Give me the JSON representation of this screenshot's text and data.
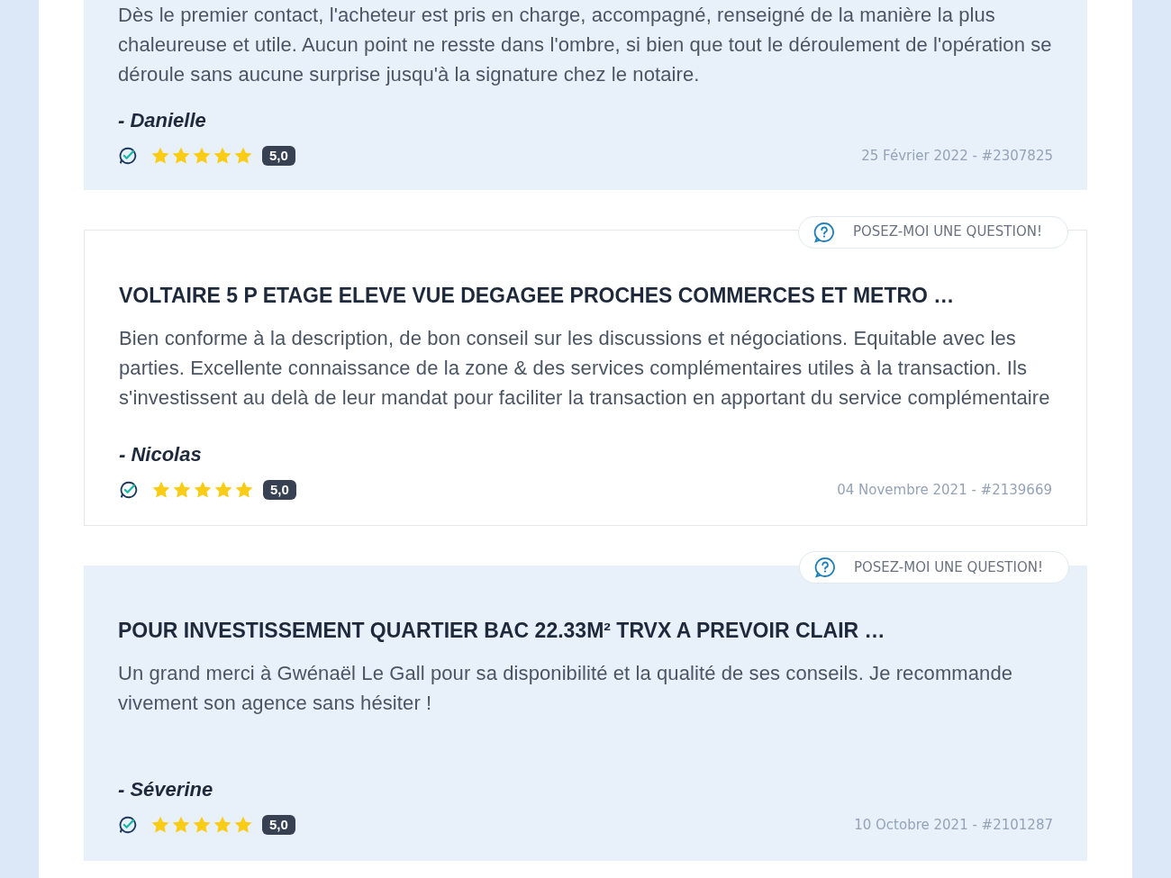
{
  "reviews": [
    {
      "kind": "tinted",
      "body": "Dès le premier contact, l'acheteur est pris en charge, accompagné, renseigné de la manière la plus chaleureuse et utile. Aucun point ne resste dans l'ombre, si bien que tout le déroulement de l'opération se déroule sans aucune surprise jusqu'à la signature chez le notaire.",
      "author": "- Danielle",
      "verified": true,
      "stars": 5,
      "rating": "5,0",
      "date": "25 Février 2022 - #2307825"
    },
    {
      "kind": "plain",
      "title": "VOLTAIRE 5 P ETAGE ELEVE VUE DEGAGEE PROCHES COMMERCES ET METRO …",
      "ask_button": "POSEZ-MOI UNE QUESTION!",
      "body": "Bien conforme à la description, de bon conseil sur les discussions et négociations. Equitable avec les parties. Excellente connaissance de la zone & des services complémentaires utiles à la transaction. Ils s'investissent au delà de leur mandat pour faciliter la transaction en apportant du service complémentaire",
      "author": "- Nicolas",
      "verified": true,
      "stars": 5,
      "rating": "5,0",
      "date": "04 Novembre 2021 - #2139669"
    },
    {
      "kind": "tinted",
      "title": "POUR INVESTISSEMENT QUARTIER BAC 22.33M² TRVX A PREVOIR CLAIR …",
      "ask_button": "POSEZ-MOI UNE QUESTION!",
      "body": "Un grand merci à Gwénaël Le Gall pour sa disponibilité et la qualité de ses conseils. Je recommande vivement son agence sans hésiter !",
      "author": "- Séverine",
      "verified": true,
      "stars": 5,
      "rating": "5,0",
      "date": "10 Octobre 2021 - #2101287"
    }
  ]
}
